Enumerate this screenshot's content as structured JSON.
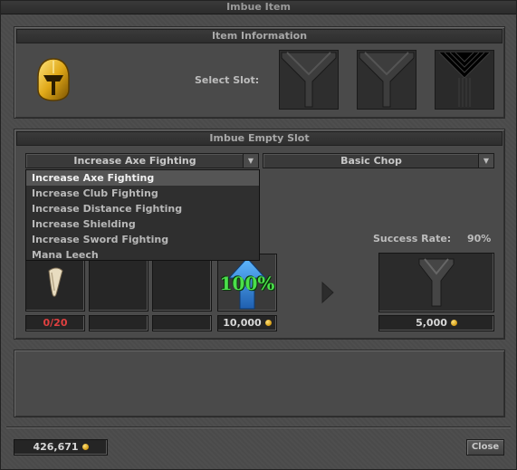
{
  "window": {
    "title": "Imbue Item"
  },
  "item_info": {
    "header": "Item Information",
    "select_slot_label": "Select Slot:",
    "item_icon": "golden-helmet-icon",
    "slots": [
      "slot-1",
      "slot-2",
      "slot-3"
    ]
  },
  "imbue": {
    "header": "Imbue Empty Slot",
    "type_dropdown": {
      "selected": "Increase Axe Fighting",
      "options": [
        "Increase Axe Fighting",
        "Increase Club Fighting",
        "Increase Distance Fighting",
        "Increase Shielding",
        "Increase Sword Fighting",
        "Mana Leech"
      ]
    },
    "tier_dropdown": {
      "selected": "Basic Chop"
    },
    "success_rate_label": "Success Rate:",
    "success_rate_value": "90%",
    "ingredient_count": "0/20",
    "protection_percent": "100%",
    "protection_cost": "10,000",
    "imbue_cost": "5,000"
  },
  "footer": {
    "balance": "426,671",
    "close_label": "Close"
  },
  "colors": {
    "count_red": "#e04040",
    "boost_green": "#4be04b",
    "arrow_blue": "#2f8de0",
    "gold": "#e0b030"
  }
}
